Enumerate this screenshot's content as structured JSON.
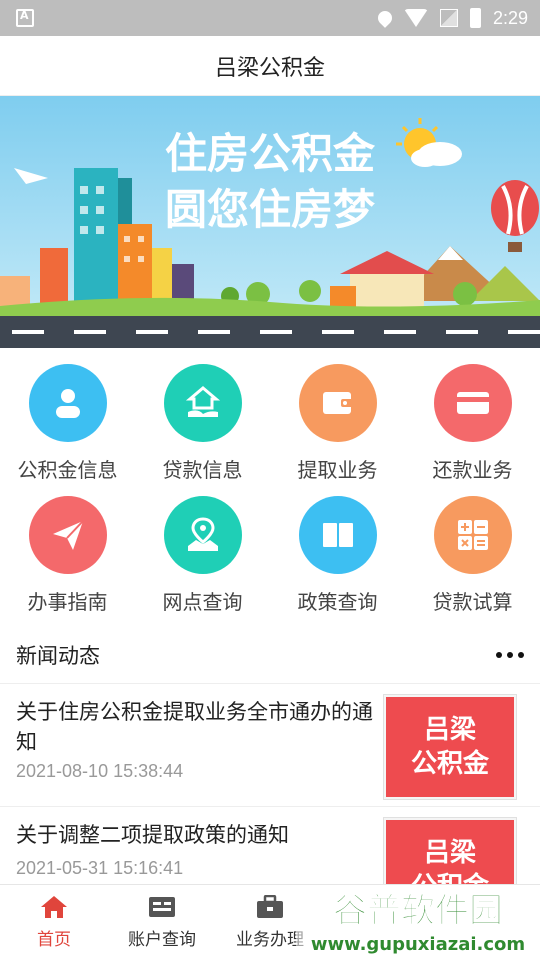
{
  "status_bar": {
    "time": "2:29"
  },
  "title": "吕梁公积金",
  "banner": {
    "line1": "住房公积金",
    "line2": "圆您住房梦"
  },
  "grid": [
    {
      "label": "公积金信息",
      "color": "#3dbff2",
      "icon": "person-icon"
    },
    {
      "label": "贷款信息",
      "color": "#1fcfb6",
      "icon": "house-hand-icon"
    },
    {
      "label": "提取业务",
      "color": "#f79a5f",
      "icon": "wallet-icon"
    },
    {
      "label": "还款业务",
      "color": "#f4696b",
      "icon": "card-icon"
    },
    {
      "label": "办事指南",
      "color": "#f4696b",
      "icon": "paper-plane-icon"
    },
    {
      "label": "网点查询",
      "color": "#1fcfb6",
      "icon": "map-pin-icon"
    },
    {
      "label": "政策查询",
      "color": "#3dbff2",
      "icon": "book-icon"
    },
    {
      "label": "贷款试算",
      "color": "#f79a5f",
      "icon": "calculator-icon"
    }
  ],
  "news": {
    "header": "新闻动态",
    "items": [
      {
        "title": "关于住房公积金提取业务全市通办的通知",
        "date": "2021-08-10 15:38:44",
        "thumb_line1": "吕梁",
        "thumb_line2": "公积金"
      },
      {
        "title": "关于调整二项提取政策的通知",
        "date": "2021-05-31 15:16:41",
        "thumb_line1": "吕梁",
        "thumb_line2": "公积金"
      }
    ]
  },
  "tabs": [
    {
      "label": "首页",
      "active": true
    },
    {
      "label": "账户查询",
      "active": false
    },
    {
      "label": "业务办理",
      "active": false
    },
    {
      "label": "",
      "active": false
    },
    {
      "label": "",
      "active": false
    }
  ],
  "watermark": {
    "line1": "谷普软件园",
    "line2": "www.gupuxiazai.com"
  },
  "colors": {
    "accent": "#e0453c",
    "thumb": "#ee4b4f"
  }
}
